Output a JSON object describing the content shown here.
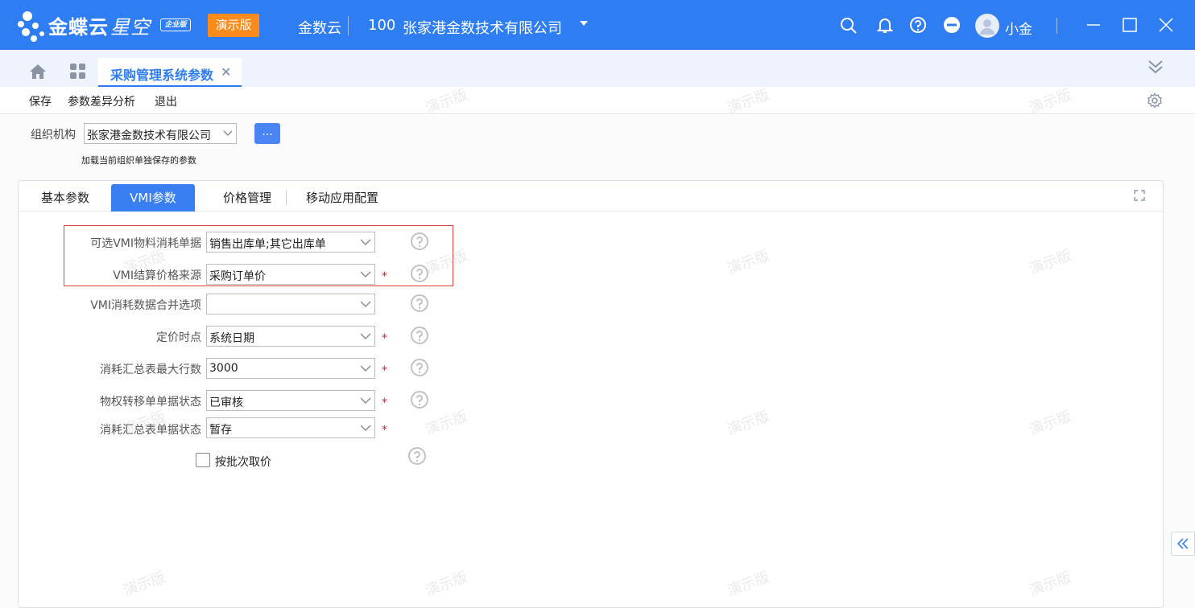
{
  "topbar": {
    "product_name": "金蝶云",
    "product_sub": "星空",
    "edition": "企业版",
    "demo_badge": "演示版",
    "brand": "金数云",
    "account_no": "100",
    "company": "张家港金数技术有限公司",
    "user_name": "小金",
    "accent_color": "#2f7df2"
  },
  "tabstrip": {
    "doc_tab_label": "采购管理系统参数",
    "close_glyph": "✕"
  },
  "toolbar": {
    "save": "保存",
    "diff_analysis": "参数差异分析",
    "exit": "退出"
  },
  "org": {
    "label": "组织机构",
    "value": "张家港金数技术有限公司",
    "button": "...",
    "hint": "加载当前组织单独保存的参数"
  },
  "tabs": {
    "basic": "基本参数",
    "vmi": "VMI参数",
    "price": "价格管理",
    "mobile": "移动应用配置"
  },
  "form": {
    "row1": {
      "label": "可选VMI物料消耗单据",
      "value": "销售出库单;其它出库单"
    },
    "row2": {
      "label": "VMI结算价格来源",
      "value": "采购订单价"
    },
    "row3": {
      "label": "VMI消耗数据合并选项",
      "value": ""
    },
    "row4": {
      "label": "定价时点",
      "value": "系统日期"
    },
    "row5": {
      "label": "消耗汇总表最大行数",
      "value": "3000"
    },
    "row6": {
      "label": "物权转移单单据状态",
      "value": "已审核"
    },
    "row7": {
      "label": "消耗汇总表单据状态",
      "value": "暂存"
    },
    "required_mark": "*",
    "checkbox_label": "按批次取价"
  },
  "watermark": "演示版"
}
